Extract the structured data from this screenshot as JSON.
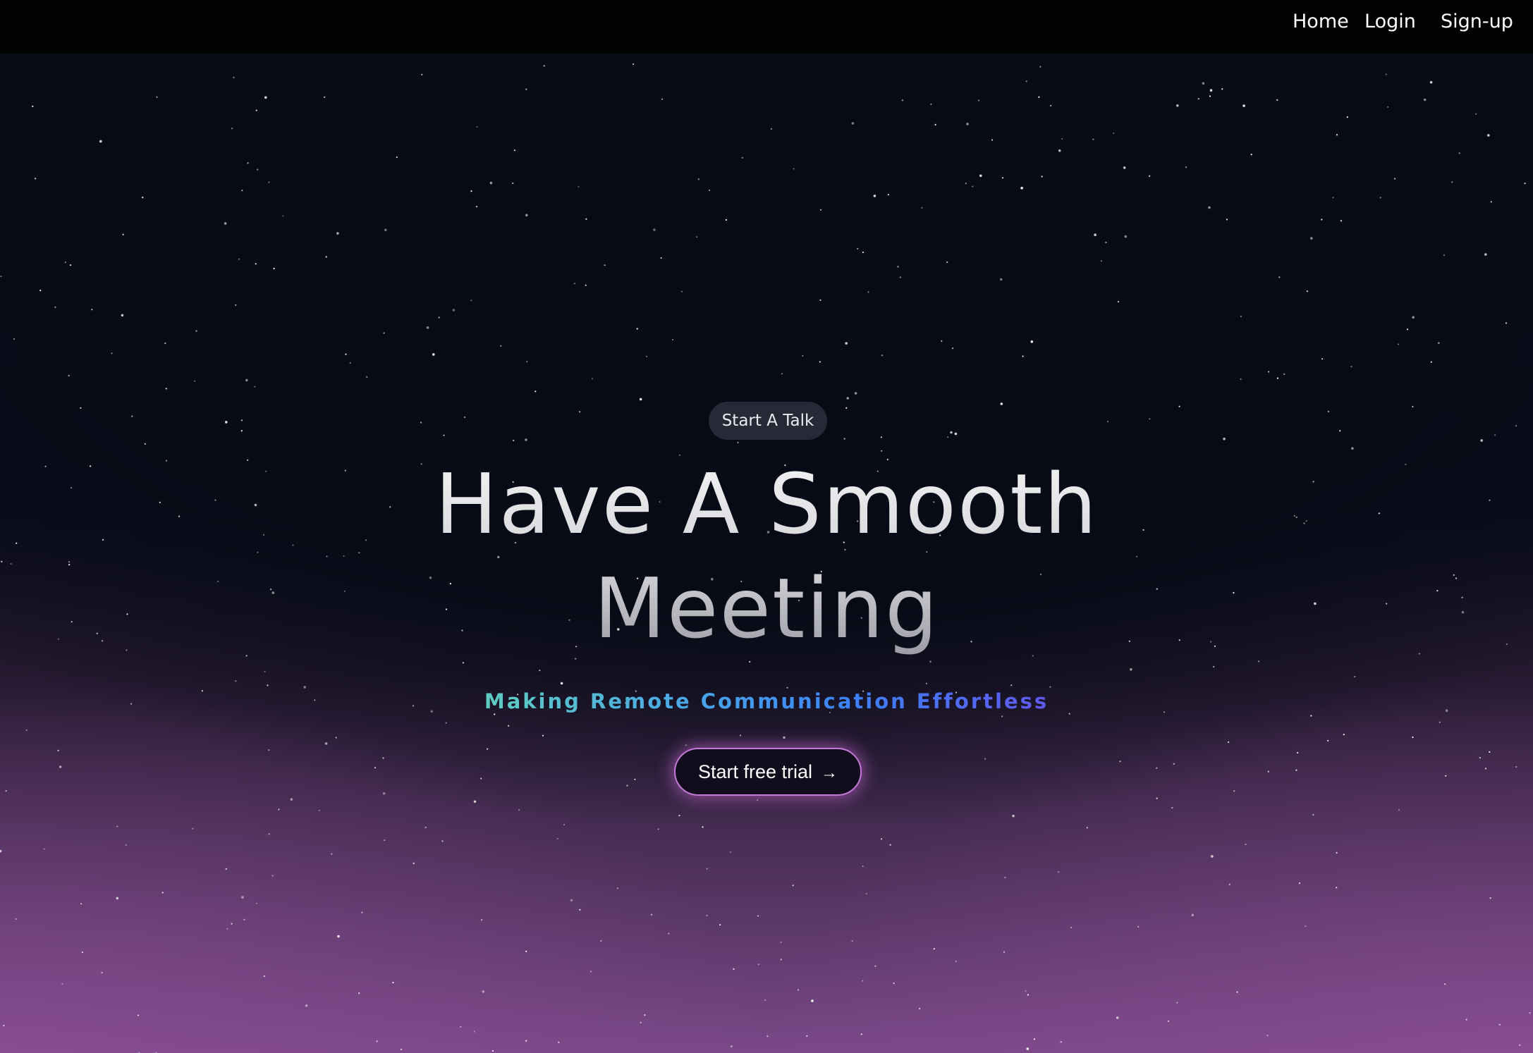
{
  "nav": {
    "home": "Home",
    "login": "Login",
    "signup": "Sign-up"
  },
  "hero": {
    "badge": "Start A Talk",
    "title_line1": "Have A Smooth",
    "title_line2": "Meeting",
    "subtitle": "Making Remote Communication Effortless",
    "cta_label": "Start free trial",
    "cta_icon": "arrow-right-icon"
  },
  "colors": {
    "background": "#070b16",
    "navbar": "#020204",
    "glow": "#7b4888",
    "subtitle_gradient_start": "#6ee7a8",
    "subtitle_gradient_mid": "#3b82f6",
    "subtitle_gradient_end": "#7c3aed",
    "cta_border": "#c27ad6"
  }
}
